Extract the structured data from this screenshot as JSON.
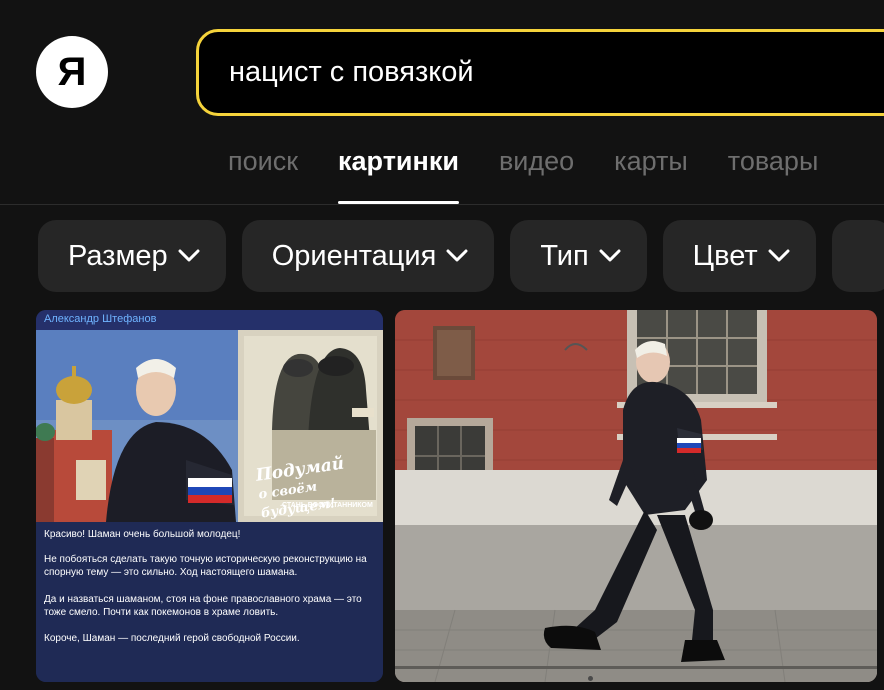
{
  "header": {
    "logo_letter": "Я",
    "search_value": "нацист с повязкой"
  },
  "tabs": [
    {
      "label": "поиск",
      "active": false
    },
    {
      "label": "картинки",
      "active": true
    },
    {
      "label": "видео",
      "active": false
    },
    {
      "label": "карты",
      "active": false
    },
    {
      "label": "товары",
      "active": false
    }
  ],
  "filters": [
    {
      "label": "Размер"
    },
    {
      "label": "Ориентация"
    },
    {
      "label": "Тип"
    },
    {
      "label": "Цвет"
    }
  ],
  "results": [
    {
      "author": "Александр Штефанов",
      "poster_text_line1": "Подумай",
      "poster_text_line2": "о своём будущем!",
      "poster_subtext": "СТАНЬ ВОСПИТАННИКОМ",
      "post_text": [
        "Красиво! Шаман очень большой молодец!",
        "Не побояться сделать такую точную историческую реконструкцию на спорную тему — это сильно. Ход настоящего шамана.",
        "Да и назваться шаманом, стоя на фоне православного храма — это тоже смело. Почти как покемонов в храме ловить.",
        "Короче, Шаман — последний герой свободной России."
      ]
    },
    {
      "description_icon": "photo-man-walking-red-wall"
    }
  ],
  "colors": {
    "background": "#121212",
    "search_border": "#f5d33b",
    "chip_bg": "#262626",
    "tab_inactive": "#6e6e6e"
  }
}
